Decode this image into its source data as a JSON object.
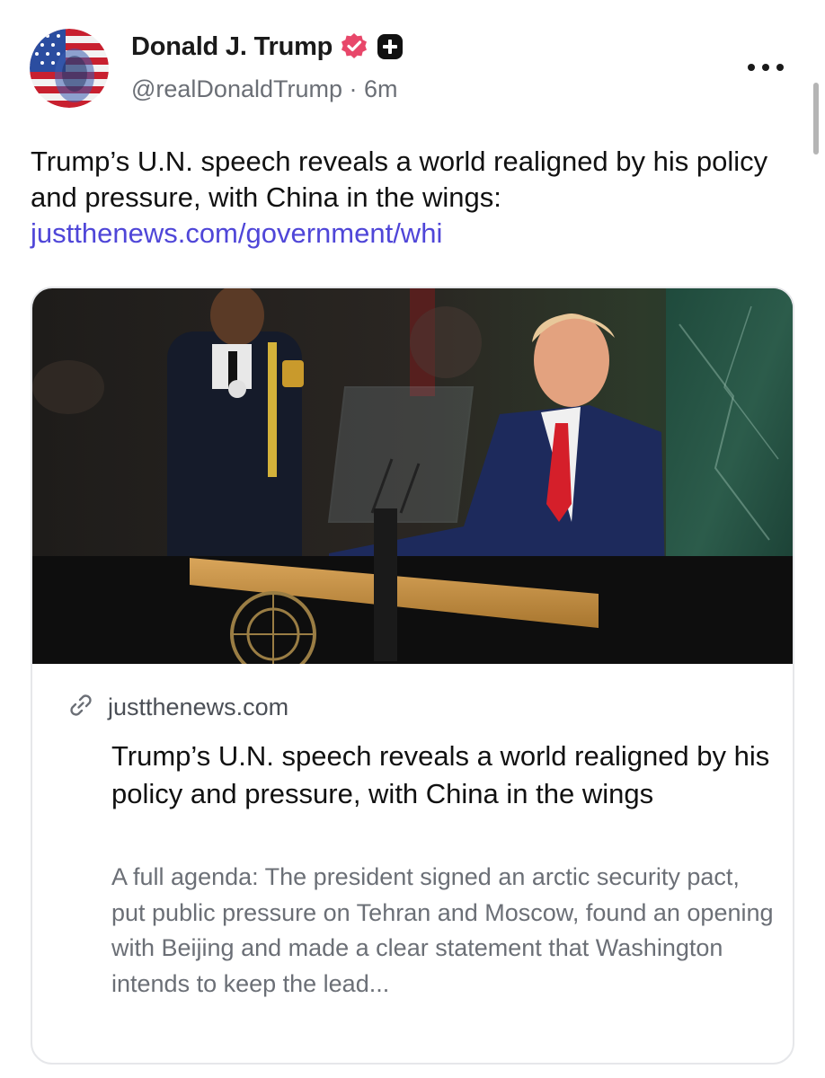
{
  "author": {
    "display_name": "Donald J. Trump",
    "handle": "@realDonaldTrump",
    "separator": "·",
    "time_ago": "6m",
    "verified_badge_icon": "verified-badge-icon",
    "plus_badge_icon": "plus-badge-icon",
    "avatar_icon": "avatar-flag-portrait"
  },
  "post": {
    "text": "Trump’s U.N. speech reveals a world realigned by his policy and pressure, with China in the wings:",
    "link_text": "justthenews.com/government/whi"
  },
  "link_card": {
    "domain": "justthenews.com",
    "domain_icon": "link-icon",
    "title": "Trump’s U.N. speech reveals a world realigned by his policy and pressure, with China in the wings",
    "description": "A full agenda: The president signed an arctic security pact, put public pressure on Tehran and Moscow, found an opening with Beijing and made a clear statement that Washington intends to keep the lead..."
  },
  "colors": {
    "link": "#4f46d8",
    "verified_badge": "#e8476a",
    "muted_text": "#6b6f76",
    "card_border": "#e6e7ea"
  }
}
